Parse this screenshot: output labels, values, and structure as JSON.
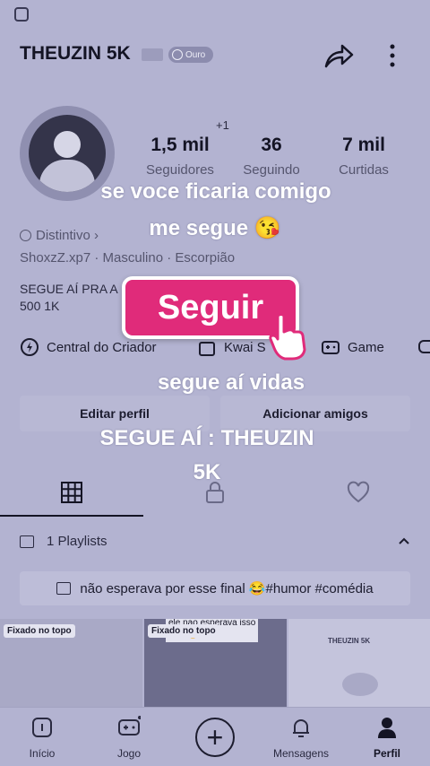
{
  "header": {
    "username": "THEUZIN 5K",
    "badge_label": "Ouro"
  },
  "stats": {
    "plus_one": "+1",
    "followers": {
      "value": "1,5 mil",
      "label": "Seguidores"
    },
    "following": {
      "value": "36",
      "label": "Seguindo"
    },
    "likes": {
      "value": "7 mil",
      "label": "Curtidas"
    }
  },
  "overlay": {
    "line1": "se voce ficaria comigo",
    "line2": "me segue 😘",
    "line3": "segue aí vidas",
    "line4": "SEGUE AÍ : THEUZIN",
    "line5": "5K"
  },
  "profile": {
    "distintivo": "Distintivo",
    "meta": "ShoxzZ.xp7  ·  Masculino  ·  Escorpião",
    "bio_line1": "SEGUE AÍ PRA A",
    "bio_line2": "500     1K"
  },
  "follow_button": {
    "label": "Seguir"
  },
  "shortcuts": {
    "creator_center": "Central do Criador",
    "kwai_shop": "Kwai S",
    "game": "Game"
  },
  "actions": {
    "edit_profile": "Editar perfil",
    "add_friends": "Adicionar amigos"
  },
  "playlists": {
    "header": "1 Playlists",
    "item": "não esperava por esse final 😂#humor #comédia"
  },
  "thumbnails": [
    {
      "tag": "Fixado no topo"
    },
    {
      "tag": "Fixado no topo",
      "caption": "ele nao esperava isso\nfinal 😂"
    },
    {
      "caption": "THEUZIN 5K"
    }
  ],
  "bottom_nav": {
    "home": "Início",
    "game": "Jogo",
    "messages": "Mensagens",
    "profile": "Perfil"
  },
  "colors": {
    "accent": "#e02b7a",
    "background": "#b3b3d1"
  }
}
